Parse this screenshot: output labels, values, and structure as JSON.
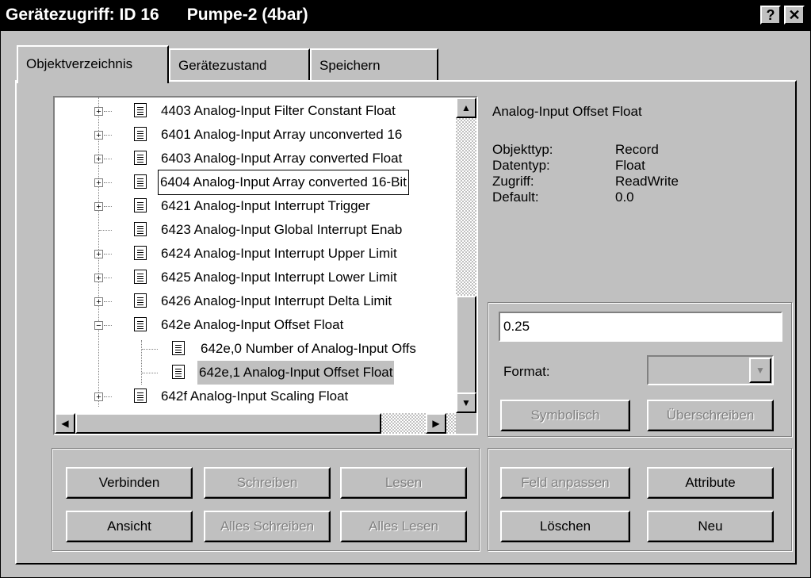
{
  "window": {
    "title": "Gerätezugriff: ID 16      Pumpe-2 (4bar)",
    "help_label": "?",
    "close_label": "✕"
  },
  "tabs": [
    {
      "label": "Objektverzeichnis",
      "active": true
    },
    {
      "label": "Gerätezustand",
      "active": false
    },
    {
      "label": "Speichern",
      "active": false
    }
  ],
  "tree": {
    "items": [
      {
        "label": "4403 Analog-Input Filter Constant Float",
        "expander": "+"
      },
      {
        "label": "6401 Analog-Input Array unconverted 16",
        "expander": "+"
      },
      {
        "label": "6403 Analog-Input Array converted Float",
        "expander": "+"
      },
      {
        "label": "6404 Analog-Input Array converted 16-Bit",
        "expander": "+"
      },
      {
        "label": "6421 Analog-Input Interrupt Trigger",
        "expander": "+"
      },
      {
        "label": "6423 Analog-Input Global Interrupt Enab",
        "expander": ""
      },
      {
        "label": "6424 Analog-Input Interrupt Upper Limit",
        "expander": "+"
      },
      {
        "label": "6425 Analog-Input Interrupt Lower Limit",
        "expander": "+"
      },
      {
        "label": "6426 Analog-Input Interrupt Delta Limit",
        "expander": "+"
      },
      {
        "label": "642e Analog-Input Offset Float",
        "expander": "−"
      },
      {
        "label": "642e,0 Number of Analog-Input Offs",
        "expander": ""
      },
      {
        "label": "642e,1 Analog-Input Offset Float",
        "expander": ""
      },
      {
        "label": "642f Analog-Input Scaling Float",
        "expander": "+"
      }
    ],
    "scroll_up": "▲",
    "scroll_down": "▼",
    "scroll_left": "◀",
    "scroll_right": "▶"
  },
  "details": {
    "name": "Analog-Input Offset Float",
    "fields": [
      {
        "key": "Objekttyp:",
        "value": "Record"
      },
      {
        "key": "Datentyp:",
        "value": "Float"
      },
      {
        "key": "Zugriff:",
        "value": "ReadWrite"
      },
      {
        "key": "Default:",
        "value": "0.0"
      }
    ]
  },
  "editor": {
    "value": "0.25",
    "format_label": "Format:",
    "format_value": "",
    "format_arrow": "▼",
    "symbolisch_label": "Symbolisch",
    "ueberschreiben_label": "Überschreiben"
  },
  "bottom_left_buttons": {
    "verbinden": "Verbinden",
    "schreiben": "Schreiben",
    "lesen": "Lesen",
    "ansicht": "Ansicht",
    "alles_schreiben": "Alles Schreiben",
    "alles_lesen": "Alles Lesen"
  },
  "bottom_right_buttons": {
    "feld_anpassen": "Feld anpassen",
    "attribute": "Attribute",
    "loeschen": "Löschen",
    "neu": "Neu"
  }
}
